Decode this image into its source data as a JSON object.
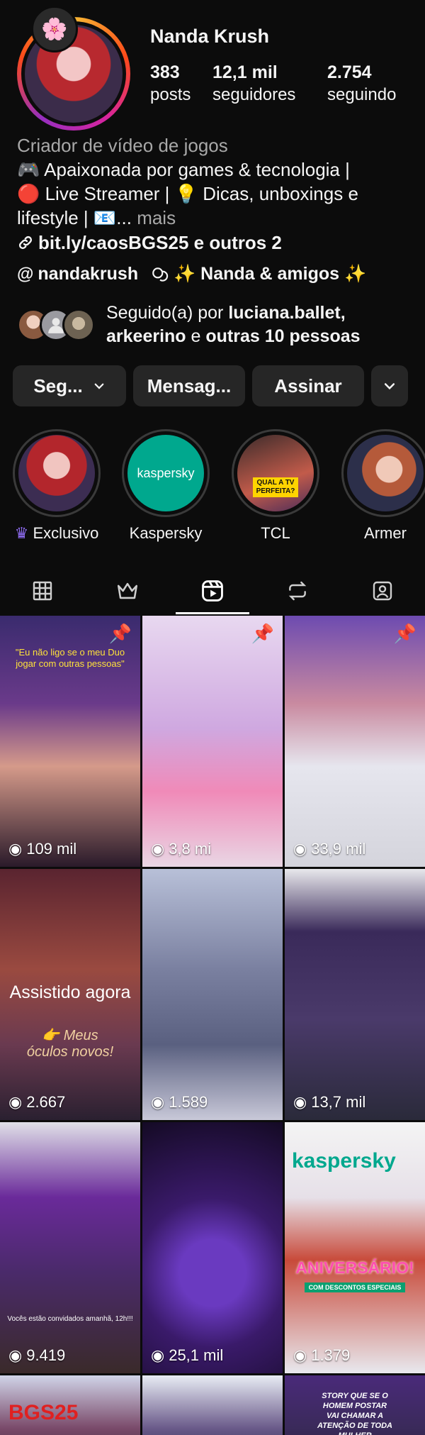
{
  "profile": {
    "name": "Nanda Krush",
    "note_emoji": "🌸",
    "stats": [
      {
        "value": "383",
        "label": "posts"
      },
      {
        "value": "12,1 mil",
        "label": "seguidores"
      },
      {
        "value": "2.754",
        "label": "seguindo"
      }
    ],
    "category": "Criador de vídeo de jogos",
    "bio_line1": "🎮 Apaixonada por games & tecnologia |",
    "bio_line2": "🔴 Live Streamer | 💡 Dicas, unboxings e",
    "bio_line3": "lifestyle | 📧...",
    "bio_more": "mais",
    "link_text": "bit.ly/caosBGS25 e outros 2",
    "threads_handle": "nandakrush",
    "channel_name": "✨ Nanda & amigos ✨",
    "followed_by_prefix": "Seguido(a) por",
    "followed_by_user1": "luciana.ballet,",
    "followed_by_user2": "arkeerino",
    "followed_by_mid": "e",
    "followed_by_rest": "outras 10 pessoas"
  },
  "actions": {
    "following": "Seg...",
    "message": "Mensag...",
    "subscribe": "Assinar"
  },
  "highlights": [
    {
      "label": "Exclusivo",
      "crown": "♛"
    },
    {
      "label": "Kaspersky",
      "image_text": "kaspersky"
    },
    {
      "label": "TCL",
      "image_text": "QUAL A TV PERFEITA?"
    },
    {
      "label": "Armer"
    }
  ],
  "tabs": [
    "grid",
    "subscriptions",
    "reels",
    "reposts",
    "tagged"
  ],
  "grid": [
    {
      "views": "109 mil",
      "pinned": true,
      "caption": "\"Eu não ligo se o meu Duo jogar com outras pessoas\""
    },
    {
      "views": "3,8 mi",
      "pinned": true
    },
    {
      "views": "33,9 mil",
      "pinned": true
    },
    {
      "views": "2.667",
      "overlay": "Assistido agora",
      "caption": "👉 Meus óculos novos!"
    },
    {
      "views": "1.589"
    },
    {
      "views": "13,7 mil"
    },
    {
      "views": "9.419",
      "caption": "Vocês estão convidados amanhã, 12h!!!"
    },
    {
      "views": "25,1 mil"
    },
    {
      "views": "1.379",
      "brand": "kaspersky",
      "caption": "ANIVERSÁRIO!",
      "subcaption": "COM DESCONTOS ESPECIAIS"
    },
    {
      "brand": "BGS25"
    },
    {},
    {
      "caption": "STORY QUE SE O HOMEM POSTAR VAI CHAMAR A ATENÇÃO DE TODA MULHER"
    }
  ]
}
